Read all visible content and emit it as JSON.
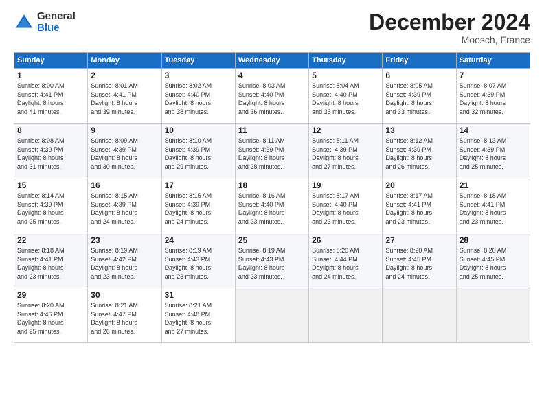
{
  "header": {
    "logo_general": "General",
    "logo_blue": "Blue",
    "title": "December 2024",
    "location": "Moosch, France"
  },
  "columns": [
    "Sunday",
    "Monday",
    "Tuesday",
    "Wednesday",
    "Thursday",
    "Friday",
    "Saturday"
  ],
  "weeks": [
    [
      {
        "day": "1",
        "info": "Sunrise: 8:00 AM\nSunset: 4:41 PM\nDaylight: 8 hours\nand 41 minutes."
      },
      {
        "day": "2",
        "info": "Sunrise: 8:01 AM\nSunset: 4:41 PM\nDaylight: 8 hours\nand 39 minutes."
      },
      {
        "day": "3",
        "info": "Sunrise: 8:02 AM\nSunset: 4:40 PM\nDaylight: 8 hours\nand 38 minutes."
      },
      {
        "day": "4",
        "info": "Sunrise: 8:03 AM\nSunset: 4:40 PM\nDaylight: 8 hours\nand 36 minutes."
      },
      {
        "day": "5",
        "info": "Sunrise: 8:04 AM\nSunset: 4:40 PM\nDaylight: 8 hours\nand 35 minutes."
      },
      {
        "day": "6",
        "info": "Sunrise: 8:05 AM\nSunset: 4:39 PM\nDaylight: 8 hours\nand 33 minutes."
      },
      {
        "day": "7",
        "info": "Sunrise: 8:07 AM\nSunset: 4:39 PM\nDaylight: 8 hours\nand 32 minutes."
      }
    ],
    [
      {
        "day": "8",
        "info": "Sunrise: 8:08 AM\nSunset: 4:39 PM\nDaylight: 8 hours\nand 31 minutes."
      },
      {
        "day": "9",
        "info": "Sunrise: 8:09 AM\nSunset: 4:39 PM\nDaylight: 8 hours\nand 30 minutes."
      },
      {
        "day": "10",
        "info": "Sunrise: 8:10 AM\nSunset: 4:39 PM\nDaylight: 8 hours\nand 29 minutes."
      },
      {
        "day": "11",
        "info": "Sunrise: 8:11 AM\nSunset: 4:39 PM\nDaylight: 8 hours\nand 28 minutes."
      },
      {
        "day": "12",
        "info": "Sunrise: 8:11 AM\nSunset: 4:39 PM\nDaylight: 8 hours\nand 27 minutes."
      },
      {
        "day": "13",
        "info": "Sunrise: 8:12 AM\nSunset: 4:39 PM\nDaylight: 8 hours\nand 26 minutes."
      },
      {
        "day": "14",
        "info": "Sunrise: 8:13 AM\nSunset: 4:39 PM\nDaylight: 8 hours\nand 25 minutes."
      }
    ],
    [
      {
        "day": "15",
        "info": "Sunrise: 8:14 AM\nSunset: 4:39 PM\nDaylight: 8 hours\nand 25 minutes."
      },
      {
        "day": "16",
        "info": "Sunrise: 8:15 AM\nSunset: 4:39 PM\nDaylight: 8 hours\nand 24 minutes."
      },
      {
        "day": "17",
        "info": "Sunrise: 8:15 AM\nSunset: 4:39 PM\nDaylight: 8 hours\nand 24 minutes."
      },
      {
        "day": "18",
        "info": "Sunrise: 8:16 AM\nSunset: 4:40 PM\nDaylight: 8 hours\nand 23 minutes."
      },
      {
        "day": "19",
        "info": "Sunrise: 8:17 AM\nSunset: 4:40 PM\nDaylight: 8 hours\nand 23 minutes."
      },
      {
        "day": "20",
        "info": "Sunrise: 8:17 AM\nSunset: 4:41 PM\nDaylight: 8 hours\nand 23 minutes."
      },
      {
        "day": "21",
        "info": "Sunrise: 8:18 AM\nSunset: 4:41 PM\nDaylight: 8 hours\nand 23 minutes."
      }
    ],
    [
      {
        "day": "22",
        "info": "Sunrise: 8:18 AM\nSunset: 4:41 PM\nDaylight: 8 hours\nand 23 minutes."
      },
      {
        "day": "23",
        "info": "Sunrise: 8:19 AM\nSunset: 4:42 PM\nDaylight: 8 hours\nand 23 minutes."
      },
      {
        "day": "24",
        "info": "Sunrise: 8:19 AM\nSunset: 4:43 PM\nDaylight: 8 hours\nand 23 minutes."
      },
      {
        "day": "25",
        "info": "Sunrise: 8:19 AM\nSunset: 4:43 PM\nDaylight: 8 hours\nand 23 minutes."
      },
      {
        "day": "26",
        "info": "Sunrise: 8:20 AM\nSunset: 4:44 PM\nDaylight: 8 hours\nand 24 minutes."
      },
      {
        "day": "27",
        "info": "Sunrise: 8:20 AM\nSunset: 4:45 PM\nDaylight: 8 hours\nand 24 minutes."
      },
      {
        "day": "28",
        "info": "Sunrise: 8:20 AM\nSunset: 4:45 PM\nDaylight: 8 hours\nand 25 minutes."
      }
    ],
    [
      {
        "day": "29",
        "info": "Sunrise: 8:20 AM\nSunset: 4:46 PM\nDaylight: 8 hours\nand 25 minutes."
      },
      {
        "day": "30",
        "info": "Sunrise: 8:21 AM\nSunset: 4:47 PM\nDaylight: 8 hours\nand 26 minutes."
      },
      {
        "day": "31",
        "info": "Sunrise: 8:21 AM\nSunset: 4:48 PM\nDaylight: 8 hours\nand 27 minutes."
      },
      {
        "day": "",
        "info": ""
      },
      {
        "day": "",
        "info": ""
      },
      {
        "day": "",
        "info": ""
      },
      {
        "day": "",
        "info": ""
      }
    ]
  ]
}
